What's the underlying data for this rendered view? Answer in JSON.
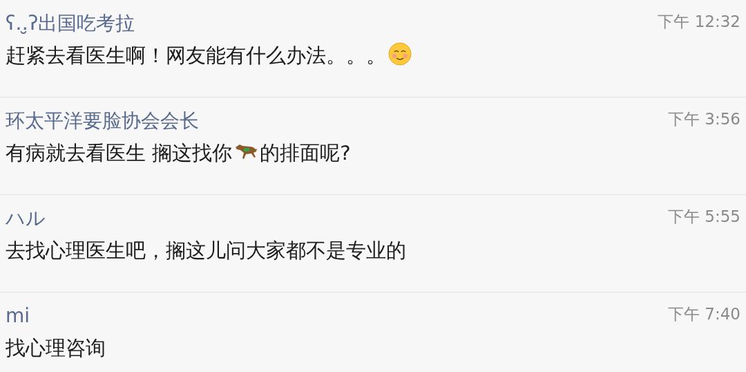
{
  "comments": [
    {
      "author": "ʕ‥̮ʔ出国吃考拉",
      "time": "下午 12:32",
      "message": [
        {
          "kind": "text",
          "text": "赶紧去看医生啊！网友能有什么办法。。。"
        },
        {
          "kind": "smile"
        }
      ]
    },
    {
      "author": "环太平洋要脸协会会长",
      "time": "下午 3:56",
      "message": [
        {
          "kind": "text",
          "text": "有病就去看医生 搁这找你"
        },
        {
          "kind": "horse"
        },
        {
          "kind": "text",
          "text": "的排面呢?"
        }
      ]
    },
    {
      "author": "ハル",
      "time": "下午 5:55",
      "message": [
        {
          "kind": "text",
          "text": "去找心理医生吧，搁这儿问大家都不是专业的"
        }
      ]
    },
    {
      "author": "mi",
      "time": "下午 7:40",
      "message": [
        {
          "kind": "text",
          "text": "找心理咨询"
        }
      ]
    }
  ]
}
